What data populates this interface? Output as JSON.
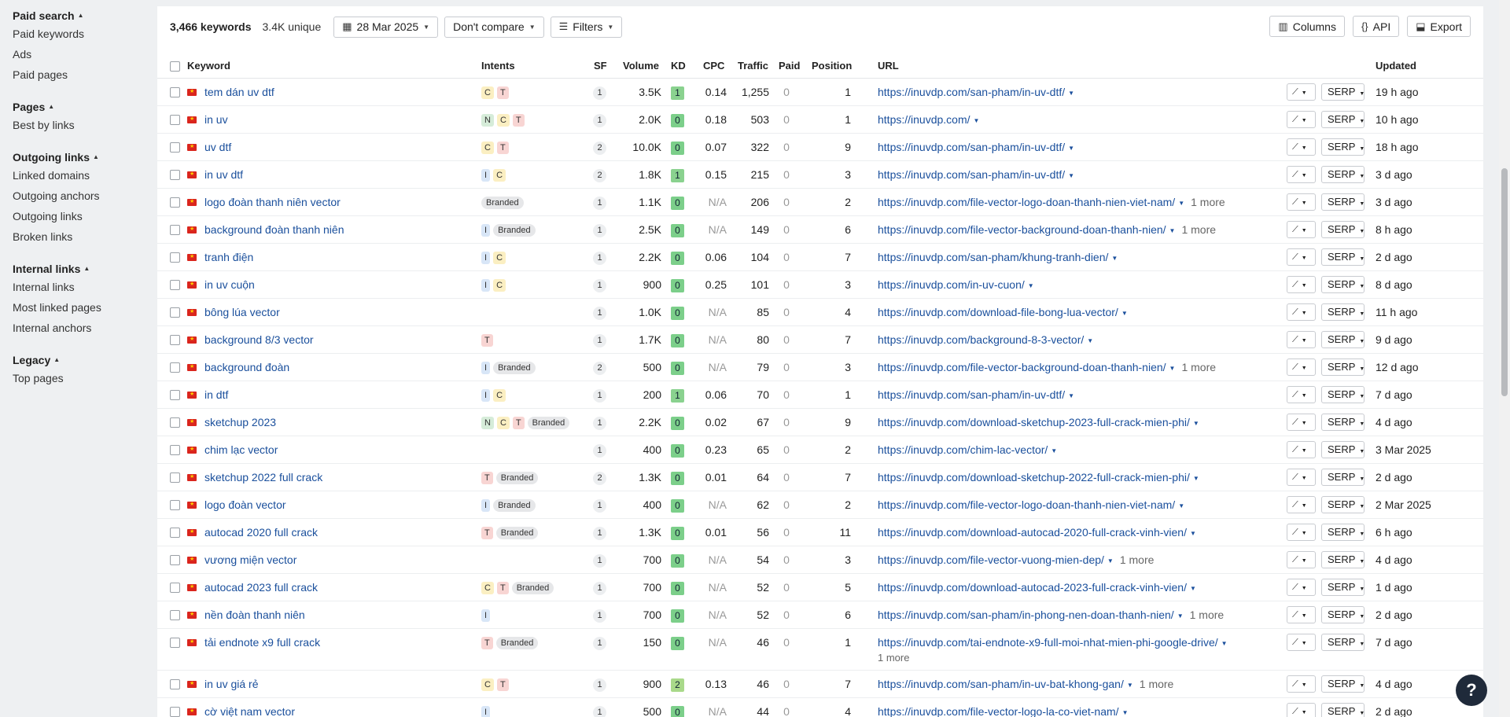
{
  "sidebar": {
    "sections": [
      {
        "title": "Paid search",
        "items": [
          "Paid keywords",
          "Ads",
          "Paid pages"
        ]
      },
      {
        "title": "Pages",
        "items": [
          "Best by links"
        ]
      },
      {
        "title": "Outgoing links",
        "items": [
          "Linked domains",
          "Outgoing anchors",
          "Outgoing links",
          "Broken links"
        ]
      },
      {
        "title": "Internal links",
        "items": [
          "Internal links",
          "Most linked pages",
          "Internal anchors"
        ]
      },
      {
        "title": "Legacy",
        "items": [
          "Top pages"
        ]
      }
    ]
  },
  "toolbar": {
    "keyword_count": "3,466 keywords",
    "unique_count": "3.4K unique",
    "date_label": "28 Mar 2025",
    "compare_label": "Don't compare",
    "filters_label": "Filters",
    "columns_label": "Columns",
    "api_label": "API",
    "export_label": "Export"
  },
  "table": {
    "headers": {
      "keyword": "Keyword",
      "intents": "Intents",
      "sf": "SF",
      "volume": "Volume",
      "kd": "KD",
      "cpc": "CPC",
      "traffic": "Traffic",
      "paid": "Paid",
      "position": "Position",
      "url": "URL",
      "updated": "Updated"
    },
    "serp_label": "SERP",
    "rows": [
      {
        "keyword": "tem dán uv dtf",
        "intents": [
          "C",
          "T"
        ],
        "sf": "1",
        "volume": "3.5K",
        "kd": "1",
        "cpc": "0.14",
        "traffic": "1,255",
        "paid": "0",
        "position": "1",
        "url": "https://inuvdp.com/san-pham/in-uv-dtf/",
        "more": "",
        "updated": "19 h ago"
      },
      {
        "keyword": "in uv",
        "intents": [
          "N",
          "C",
          "T"
        ],
        "sf": "1",
        "volume": "2.0K",
        "kd": "0",
        "cpc": "0.18",
        "traffic": "503",
        "paid": "0",
        "position": "1",
        "url": "https://inuvdp.com/",
        "more": "",
        "updated": "10 h ago"
      },
      {
        "keyword": "uv dtf",
        "intents": [
          "C",
          "T"
        ],
        "sf": "2",
        "volume": "10.0K",
        "kd": "0",
        "cpc": "0.07",
        "traffic": "322",
        "paid": "0",
        "position": "9",
        "url": "https://inuvdp.com/san-pham/in-uv-dtf/",
        "more": "",
        "updated": "18 h ago"
      },
      {
        "keyword": "in uv dtf",
        "intents": [
          "I",
          "C"
        ],
        "sf": "2",
        "volume": "1.8K",
        "kd": "1",
        "cpc": "0.15",
        "traffic": "215",
        "paid": "0",
        "position": "3",
        "url": "https://inuvdp.com/san-pham/in-uv-dtf/",
        "more": "",
        "updated": "3 d ago"
      },
      {
        "keyword": "logo đoàn thanh niên vector",
        "intents": [
          "Branded"
        ],
        "sf": "1",
        "volume": "1.1K",
        "kd": "0",
        "cpc": "N/A",
        "traffic": "206",
        "paid": "0",
        "position": "2",
        "url": "https://inuvdp.com/file-vector-logo-doan-thanh-nien-viet-nam/",
        "more": "1 more",
        "updated": "3 d ago"
      },
      {
        "keyword": "background đoàn thanh niên",
        "intents": [
          "I",
          "Branded"
        ],
        "sf": "1",
        "volume": "2.5K",
        "kd": "0",
        "cpc": "N/A",
        "traffic": "149",
        "paid": "0",
        "position": "6",
        "url": "https://inuvdp.com/file-vector-background-doan-thanh-nien/",
        "more": "1 more",
        "updated": "8 h ago"
      },
      {
        "keyword": "tranh điện",
        "intents": [
          "I",
          "C"
        ],
        "sf": "1",
        "volume": "2.2K",
        "kd": "0",
        "cpc": "0.06",
        "traffic": "104",
        "paid": "0",
        "position": "7",
        "url": "https://inuvdp.com/san-pham/khung-tranh-dien/",
        "more": "",
        "updated": "2 d ago"
      },
      {
        "keyword": "in uv cuộn",
        "intents": [
          "I",
          "C"
        ],
        "sf": "1",
        "volume": "900",
        "kd": "0",
        "cpc": "0.25",
        "traffic": "101",
        "paid": "0",
        "position": "3",
        "url": "https://inuvdp.com/in-uv-cuon/",
        "more": "",
        "updated": "8 d ago"
      },
      {
        "keyword": "bông lúa vector",
        "intents": [],
        "sf": "1",
        "volume": "1.0K",
        "kd": "0",
        "cpc": "N/A",
        "traffic": "85",
        "paid": "0",
        "position": "4",
        "url": "https://inuvdp.com/download-file-bong-lua-vector/",
        "more": "",
        "updated": "11 h ago"
      },
      {
        "keyword": "background 8/3 vector",
        "intents": [
          "T"
        ],
        "sf": "1",
        "volume": "1.7K",
        "kd": "0",
        "cpc": "N/A",
        "traffic": "80",
        "paid": "0",
        "position": "7",
        "url": "https://inuvdp.com/background-8-3-vector/",
        "more": "",
        "updated": "9 d ago"
      },
      {
        "keyword": "background đoàn",
        "intents": [
          "I",
          "Branded"
        ],
        "sf": "2",
        "volume": "500",
        "kd": "0",
        "cpc": "N/A",
        "traffic": "79",
        "paid": "0",
        "position": "3",
        "url": "https://inuvdp.com/file-vector-background-doan-thanh-nien/",
        "more": "1 more",
        "updated": "12 d ago"
      },
      {
        "keyword": "in dtf",
        "intents": [
          "I",
          "C"
        ],
        "sf": "1",
        "volume": "200",
        "kd": "1",
        "cpc": "0.06",
        "traffic": "70",
        "paid": "0",
        "position": "1",
        "url": "https://inuvdp.com/san-pham/in-uv-dtf/",
        "more": "",
        "updated": "7 d ago"
      },
      {
        "keyword": "sketchup 2023",
        "intents": [
          "N",
          "C",
          "T",
          "Branded"
        ],
        "sf": "1",
        "volume": "2.2K",
        "kd": "0",
        "cpc": "0.02",
        "traffic": "67",
        "paid": "0",
        "position": "9",
        "url": "https://inuvdp.com/download-sketchup-2023-full-crack-mien-phi/",
        "more": "",
        "updated": "4 d ago"
      },
      {
        "keyword": "chim lạc vector",
        "intents": [],
        "sf": "1",
        "volume": "400",
        "kd": "0",
        "cpc": "0.23",
        "traffic": "65",
        "paid": "0",
        "position": "2",
        "url": "https://inuvdp.com/chim-lac-vector/",
        "more": "",
        "updated": "3 Mar 2025"
      },
      {
        "keyword": "sketchup 2022 full crack",
        "intents": [
          "T",
          "Branded"
        ],
        "sf": "2",
        "volume": "1.3K",
        "kd": "0",
        "cpc": "0.01",
        "traffic": "64",
        "paid": "0",
        "position": "7",
        "url": "https://inuvdp.com/download-sketchup-2022-full-crack-mien-phi/",
        "more": "",
        "updated": "2 d ago"
      },
      {
        "keyword": "logo đoàn vector",
        "intents": [
          "I",
          "Branded"
        ],
        "sf": "1",
        "volume": "400",
        "kd": "0",
        "cpc": "N/A",
        "traffic": "62",
        "paid": "0",
        "position": "2",
        "url": "https://inuvdp.com/file-vector-logo-doan-thanh-nien-viet-nam/",
        "more": "",
        "updated": "2 Mar 2025"
      },
      {
        "keyword": "autocad 2020 full crack",
        "intents": [
          "T",
          "Branded"
        ],
        "sf": "1",
        "volume": "1.3K",
        "kd": "0",
        "cpc": "0.01",
        "traffic": "56",
        "paid": "0",
        "position": "11",
        "url": "https://inuvdp.com/download-autocad-2020-full-crack-vinh-vien/",
        "more": "",
        "updated": "6 h ago"
      },
      {
        "keyword": "vương miện vector",
        "intents": [],
        "sf": "1",
        "volume": "700",
        "kd": "0",
        "cpc": "N/A",
        "traffic": "54",
        "paid": "0",
        "position": "3",
        "url": "https://inuvdp.com/file-vector-vuong-mien-dep/",
        "more": "1 more",
        "updated": "4 d ago"
      },
      {
        "keyword": "autocad 2023 full crack",
        "intents": [
          "C",
          "T",
          "Branded"
        ],
        "sf": "1",
        "volume": "700",
        "kd": "0",
        "cpc": "N/A",
        "traffic": "52",
        "paid": "0",
        "position": "5",
        "url": "https://inuvdp.com/download-autocad-2023-full-crack-vinh-vien/",
        "more": "",
        "updated": "1 d ago"
      },
      {
        "keyword": "nền đoàn thanh niên",
        "intents": [
          "I"
        ],
        "sf": "1",
        "volume": "700",
        "kd": "0",
        "cpc": "N/A",
        "traffic": "52",
        "paid": "0",
        "position": "6",
        "url": "https://inuvdp.com/san-pham/in-phong-nen-doan-thanh-nien/",
        "more": "1 more",
        "updated": "2 d ago"
      },
      {
        "keyword": "tải endnote x9 full crack",
        "intents": [
          "T",
          "Branded"
        ],
        "sf": "1",
        "volume": "150",
        "kd": "0",
        "cpc": "N/A",
        "traffic": "46",
        "paid": "0",
        "position": "1",
        "url": "https://inuvdp.com/tai-endnote-x9-full-moi-nhat-mien-phi-google-drive/",
        "more_below": "1 more",
        "updated": "7 d ago"
      },
      {
        "keyword": "in uv giá rẻ",
        "intents": [
          "C",
          "T"
        ],
        "sf": "1",
        "volume": "900",
        "kd": "2",
        "cpc": "0.13",
        "traffic": "46",
        "paid": "0",
        "position": "7",
        "url": "https://inuvdp.com/san-pham/in-uv-bat-khong-gan/",
        "more": "1 more",
        "updated": "4 d ago"
      },
      {
        "keyword": "cờ việt nam vector",
        "intents": [
          "I"
        ],
        "sf": "1",
        "volume": "500",
        "kd": "0",
        "cpc": "N/A",
        "traffic": "44",
        "paid": "0",
        "position": "4",
        "url": "https://inuvdp.com/file-vector-logo-la-co-viet-nam/",
        "more": "",
        "updated": "2 d ago"
      }
    ]
  },
  "help_label": "?"
}
